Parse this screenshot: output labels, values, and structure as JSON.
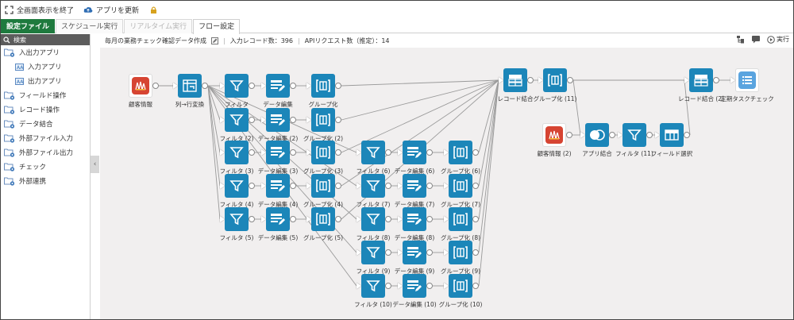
{
  "topbar": {
    "exit_fullscreen": "全画面表示を終了",
    "update_app": "アプリを更新"
  },
  "tabs": [
    {
      "label": "設定ファイル",
      "style": "green"
    },
    {
      "label": "スケジュール実行",
      "style": "normal"
    },
    {
      "label": "リアルタイム実行",
      "style": "disabled"
    },
    {
      "label": "フロー設定",
      "style": "current"
    }
  ],
  "sidebar": {
    "search_placeholder": "検索",
    "items": [
      {
        "label": "入出力アプリ",
        "sub": false
      },
      {
        "label": "入力アプリ",
        "sub": true
      },
      {
        "label": "出力アプリ",
        "sub": true
      },
      {
        "label": "フィールド操作",
        "sub": false
      },
      {
        "label": "レコード操作",
        "sub": false
      },
      {
        "label": "データ結合",
        "sub": false
      },
      {
        "label": "外部ファイル入力",
        "sub": false
      },
      {
        "label": "外部ファイル出力",
        "sub": false
      },
      {
        "label": "チェック",
        "sub": false
      },
      {
        "label": "外部連携",
        "sub": false
      }
    ]
  },
  "header": {
    "flow_name": "毎月の業務チェック確認データ作成",
    "input_records": "入力レコード数：396",
    "api_requests": "APIリクエスト数（推定）：14",
    "run_label": "実行"
  },
  "nodes": [
    {
      "id": "n0",
      "label": "顧客情報",
      "kind": "app"
    },
    {
      "id": "n1",
      "label": "列→行変換",
      "kind": "pivot"
    },
    {
      "id": "f1",
      "label": "フィルタ",
      "kind": "filter"
    },
    {
      "id": "e1",
      "label": "データ編集",
      "kind": "edit"
    },
    {
      "id": "g1",
      "label": "グループ化",
      "kind": "group"
    },
    {
      "id": "f2",
      "label": "フィルタ (2)",
      "kind": "filter"
    },
    {
      "id": "e2",
      "label": "データ編集 (2)",
      "kind": "edit"
    },
    {
      "id": "g2",
      "label": "グループ化 (2)",
      "kind": "group"
    },
    {
      "id": "f3",
      "label": "フィルタ (3)",
      "kind": "filter"
    },
    {
      "id": "e3",
      "label": "データ編集 (3)",
      "kind": "edit"
    },
    {
      "id": "g3",
      "label": "グループ化 (3)",
      "kind": "group"
    },
    {
      "id": "f4",
      "label": "フィルタ (4)",
      "kind": "filter"
    },
    {
      "id": "e4",
      "label": "データ編集 (4)",
      "kind": "edit"
    },
    {
      "id": "g4",
      "label": "グループ化 (4)",
      "kind": "group"
    },
    {
      "id": "f5",
      "label": "フィルタ (5)",
      "kind": "filter"
    },
    {
      "id": "e5",
      "label": "データ編集 (5)",
      "kind": "edit"
    },
    {
      "id": "g5",
      "label": "グループ化 (5)",
      "kind": "group"
    },
    {
      "id": "f6",
      "label": "フィルタ (6)",
      "kind": "filter"
    },
    {
      "id": "e6",
      "label": "データ編集 (6)",
      "kind": "edit"
    },
    {
      "id": "g6",
      "label": "グループ化 (6)",
      "kind": "group"
    },
    {
      "id": "f7",
      "label": "フィルタ (7)",
      "kind": "filter"
    },
    {
      "id": "e7",
      "label": "データ編集 (7)",
      "kind": "edit"
    },
    {
      "id": "g7",
      "label": "グループ化 (7)",
      "kind": "group"
    },
    {
      "id": "f8",
      "label": "フィルタ (8)",
      "kind": "filter"
    },
    {
      "id": "e8",
      "label": "データ編集 (8)",
      "kind": "edit"
    },
    {
      "id": "g8",
      "label": "グループ化 (8)",
      "kind": "group"
    },
    {
      "id": "f9",
      "label": "フィルタ (9)",
      "kind": "filter"
    },
    {
      "id": "e9",
      "label": "データ編集 (9)",
      "kind": "edit"
    },
    {
      "id": "g9",
      "label": "グループ化 (9)",
      "kind": "group"
    },
    {
      "id": "f10",
      "label": "フィルタ (10)",
      "kind": "filter"
    },
    {
      "id": "e10",
      "label": "データ編集 (10)",
      "kind": "edit"
    },
    {
      "id": "g10",
      "label": "グループ化 (10)",
      "kind": "group"
    },
    {
      "id": "r1",
      "label": "レコード結合",
      "kind": "merge"
    },
    {
      "id": "g11",
      "label": "グループ化 (11)",
      "kind": "group"
    },
    {
      "id": "n2",
      "label": "顧客情報 (2)",
      "kind": "app"
    },
    {
      "id": "j1",
      "label": "アプリ結合",
      "kind": "join"
    },
    {
      "id": "f11",
      "label": "フィルタ (11)",
      "kind": "filter"
    },
    {
      "id": "s1",
      "label": "フィールド選択",
      "kind": "select"
    },
    {
      "id": "r2",
      "label": "レコード結合 (2)",
      "kind": "merge"
    },
    {
      "id": "t1",
      "label": "定期タスクチェック",
      "kind": "task"
    }
  ],
  "edges": [
    [
      "n0",
      "n1"
    ],
    [
      "n1",
      "f1"
    ],
    [
      "n1",
      "f2"
    ],
    [
      "n1",
      "f3"
    ],
    [
      "n1",
      "f4"
    ],
    [
      "n1",
      "f5"
    ],
    [
      "n1",
      "f6"
    ],
    [
      "n1",
      "f7"
    ],
    [
      "n1",
      "f8"
    ],
    [
      "n1",
      "f9"
    ],
    [
      "n1",
      "f10"
    ],
    [
      "f1",
      "e1"
    ],
    [
      "e1",
      "g1"
    ],
    [
      "f2",
      "e2"
    ],
    [
      "e2",
      "g2"
    ],
    [
      "f3",
      "e3"
    ],
    [
      "e3",
      "g3"
    ],
    [
      "f4",
      "e4"
    ],
    [
      "e4",
      "g4"
    ],
    [
      "f5",
      "e5"
    ],
    [
      "e5",
      "g5"
    ],
    [
      "f6",
      "e6"
    ],
    [
      "e6",
      "g6"
    ],
    [
      "f7",
      "e7"
    ],
    [
      "e7",
      "g7"
    ],
    [
      "f8",
      "e8"
    ],
    [
      "e8",
      "g8"
    ],
    [
      "f9",
      "e9"
    ],
    [
      "e9",
      "g9"
    ],
    [
      "f10",
      "e10"
    ],
    [
      "e10",
      "g10"
    ],
    [
      "g1",
      "r1"
    ],
    [
      "g2",
      "r1"
    ],
    [
      "g3",
      "r1"
    ],
    [
      "g4",
      "r1"
    ],
    [
      "g5",
      "r1"
    ],
    [
      "g6",
      "r1"
    ],
    [
      "g7",
      "r1"
    ],
    [
      "g8",
      "r1"
    ],
    [
      "g9",
      "r1"
    ],
    [
      "g10",
      "r1"
    ],
    [
      "r1",
      "g11"
    ],
    [
      "g11",
      "r2"
    ],
    [
      "g11",
      "j1"
    ],
    [
      "n2",
      "j1"
    ],
    [
      "j1",
      "f11"
    ],
    [
      "f11",
      "s1"
    ],
    [
      "s1",
      "r2"
    ],
    [
      "r2",
      "t1"
    ]
  ],
  "colors": {
    "node_blue": "#1c86b9",
    "green_tab": "#1e7a3e",
    "canvas_bg": "#f1efef"
  }
}
